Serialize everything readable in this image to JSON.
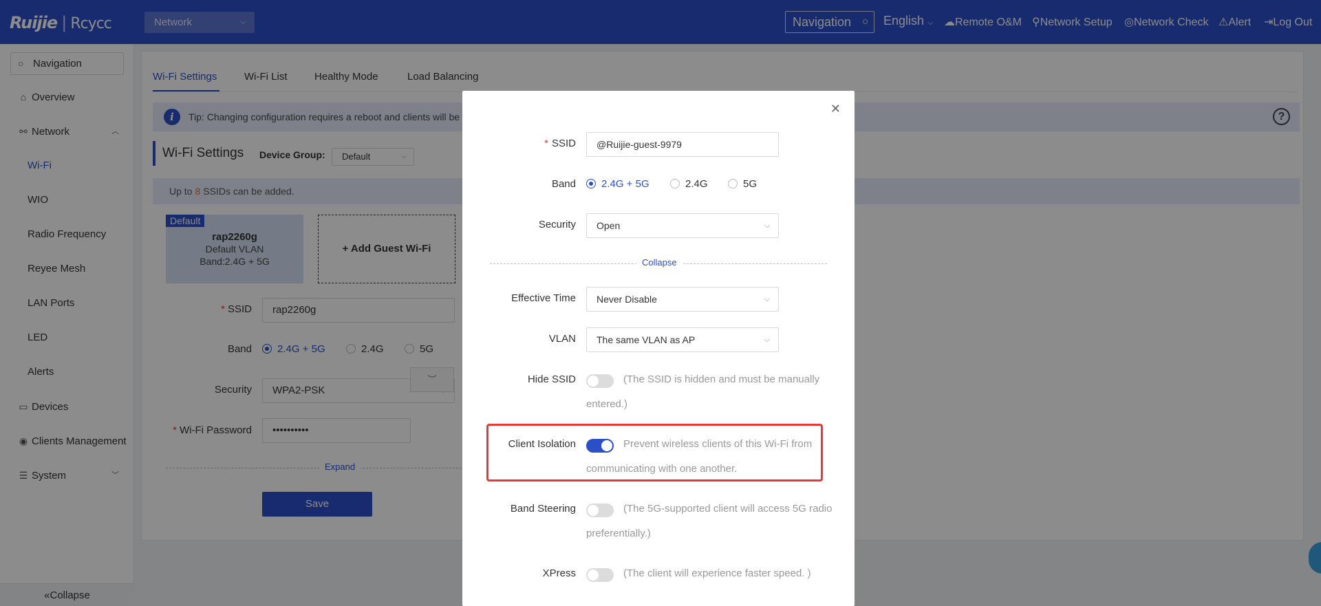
{
  "header": {
    "logo": "Ruijie",
    "logo_sub": "Rcycc",
    "network_select": "Network",
    "nav_search": "Navigation",
    "language": "English",
    "remote": "Remote O&M",
    "setup": "Network Setup",
    "check": "Network Check",
    "alert": "Alert",
    "logout": "Log Out"
  },
  "sidebar": {
    "search": "Navigation",
    "items": {
      "overview": "Overview",
      "network": "Network",
      "wifi": "Wi-Fi",
      "wio": "WIO",
      "radio": "Radio Frequency",
      "mesh": "Reyee Mesh",
      "lan": "LAN Ports",
      "led": "LED",
      "alerts": "Alerts",
      "devices": "Devices",
      "clients": "Clients Management",
      "system": "System"
    },
    "collapse": "Collapse"
  },
  "main": {
    "tabs": [
      "Wi-Fi Settings",
      "Wi-Fi List",
      "Healthy Mode",
      "Load Balancing"
    ],
    "tip": "Tip: Changing configuration requires a reboot and clients will be",
    "section_title": "Wi-Fi Settings",
    "device_group_label": "Device Group:",
    "device_group_value": "Default",
    "ssid_note_pre": "Up to",
    "ssid_note_num": "8",
    "ssid_note_post": "SSIDs can be added.",
    "card": {
      "badge": "Default",
      "name": "rap2260g",
      "vlan": "Default VLAN",
      "band": "Band:2.4G + 5G"
    },
    "add_guest": "+ Add Guest Wi-Fi",
    "form": {
      "ssid_label": "SSID",
      "ssid_value": "rap2260g",
      "band_label": "Band",
      "band_options": [
        "2.4G + 5G",
        "2.4G",
        "5G"
      ],
      "security_label": "Security",
      "security_value": "WPA2-PSK",
      "password_label": "Wi-Fi Password",
      "password_value": "••••••••••",
      "expand": "Expand",
      "save": "Save"
    }
  },
  "modal": {
    "ssid_label": "SSID",
    "ssid_value": "@Ruijie-guest-9979",
    "band_label": "Band",
    "band_options": [
      "2.4G + 5G",
      "2.4G",
      "5G"
    ],
    "security_label": "Security",
    "security_value": "Open",
    "collapse": "Collapse",
    "effective_time_label": "Effective Time",
    "effective_time_value": "Never Disable",
    "vlan_label": "VLAN",
    "vlan_value": "The same VLAN as AP",
    "hide_ssid_label": "Hide SSID",
    "hide_ssid_desc": "(The SSID is hidden and must be manually entered.)",
    "client_isolation_label": "Client Isolation",
    "client_isolation_desc": "Prevent wireless clients of this Wi-Fi from communicating with one another.",
    "band_steering_label": "Band Steering",
    "band_steering_desc": "(The 5G-supported client will access 5G radio preferentially.)",
    "xpress_label": "XPress",
    "xpress_desc": "(The client will experience faster speed. )",
    "toggles": {
      "hide_ssid": false,
      "client_isolation": true,
      "band_steering": false,
      "xpress": false
    }
  },
  "colors": {
    "primary": "#2b4fc9",
    "highlight": "#e53935",
    "required": "#e53935"
  }
}
